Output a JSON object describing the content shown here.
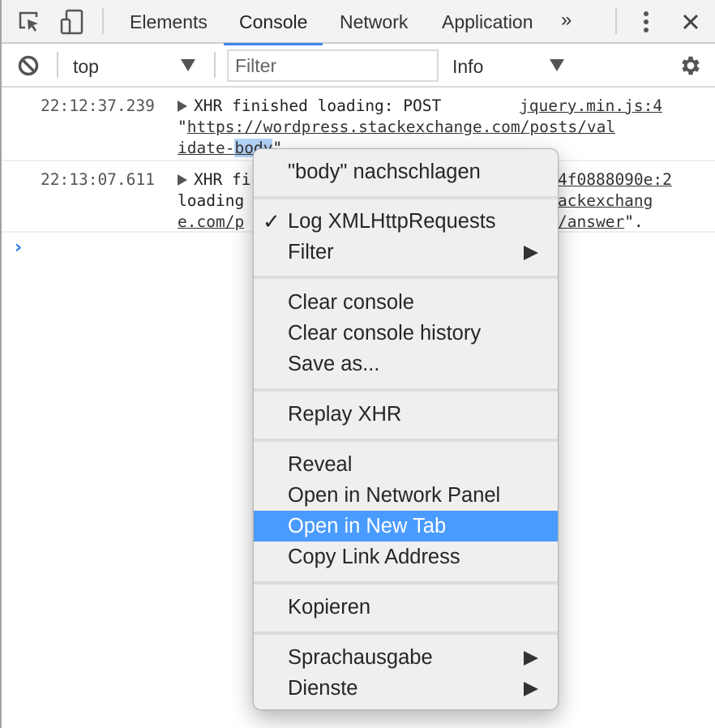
{
  "tabbar": {
    "icons": {
      "inspect": "inspect-element-icon",
      "device": "device-toolbar-icon",
      "more": "kebab-menu-icon",
      "close": "close-icon"
    },
    "tabs": [
      {
        "label": "Elements",
        "active": false
      },
      {
        "label": "Console",
        "active": true
      },
      {
        "label": "Network",
        "active": false
      },
      {
        "label": "Application",
        "active": false
      }
    ],
    "overflow_label": "»",
    "close_label": "✕"
  },
  "toolbar": {
    "context": "top",
    "filter_placeholder": "Filter",
    "filter_value": "",
    "level": "Info"
  },
  "messages": [
    {
      "timestamp": "22:12:37.239",
      "text_line1": "XHR finished loading: POST",
      "source": "jquery.min.js:4",
      "quote_open": "\"",
      "url_line2": "https://wordpress.stackexchange.com/posts/val",
      "url_line3_a": "idate-",
      "url_line3_sel": "body",
      "quote_close": "\""
    },
    {
      "timestamp": "22:13:07.611",
      "text_line1": "XHR fi",
      "source_visible": "4f0888090e:2",
      "line2_visible": "loading",
      "line2_right": "ackexchang",
      "line3_left": "e.com/p",
      "line3_right": "/answer",
      "line3_tail": "\"."
    }
  ],
  "prompt": "›",
  "context_menu": {
    "groups": [
      [
        {
          "label": "\"body\" nachschlagen"
        }
      ],
      [
        {
          "label": "Log XMLHttpRequests",
          "checked": true
        },
        {
          "label": "Filter",
          "submenu": true
        }
      ],
      [
        {
          "label": "Clear console"
        },
        {
          "label": "Clear console history"
        },
        {
          "label": "Save as..."
        }
      ],
      [
        {
          "label": "Replay XHR"
        }
      ],
      [
        {
          "label": "Reveal"
        },
        {
          "label": "Open in Network Panel"
        },
        {
          "label": "Open in New Tab",
          "highlighted": true
        },
        {
          "label": "Copy Link Address"
        }
      ],
      [
        {
          "label": "Kopieren"
        }
      ],
      [
        {
          "label": "Sprachausgabe",
          "submenu": true
        },
        {
          "label": "Dienste",
          "submenu": true
        }
      ]
    ],
    "check_glyph": "✓"
  },
  "colors": {
    "accent": "#3b86e8",
    "highlight": "#4a9bff",
    "selection": "#b3d3f7",
    "prompt": "#2a7be4"
  }
}
